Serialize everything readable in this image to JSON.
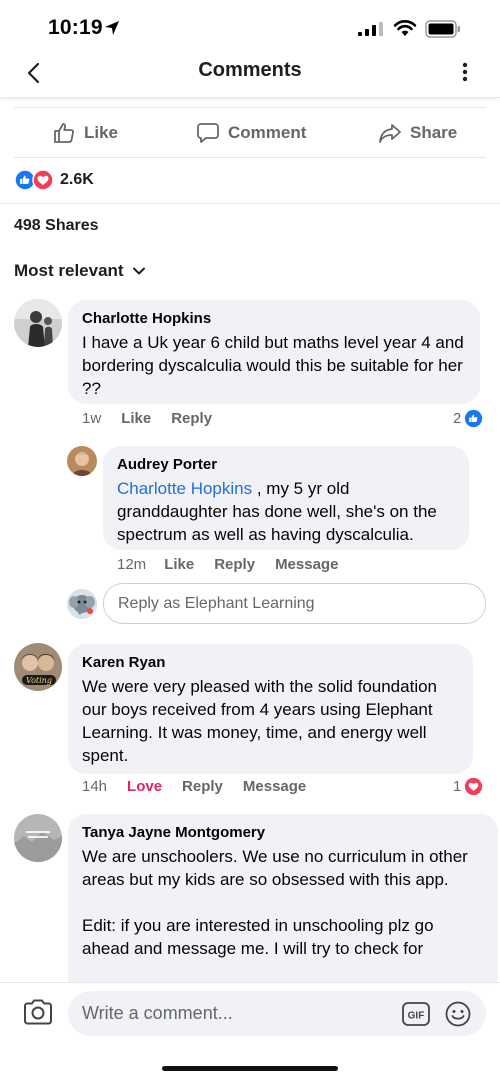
{
  "status_bar": {
    "time": "10:19"
  },
  "nav": {
    "title": "Comments"
  },
  "actions": {
    "like": "Like",
    "comment": "Comment",
    "share": "Share"
  },
  "reactions": {
    "count": "2.6K"
  },
  "shares": "498 Shares",
  "sort": {
    "label": "Most relevant"
  },
  "comments": [
    {
      "author": "Charlotte Hopkins",
      "text": "I have a Uk year 6 child but maths level year 4 and bordering dyscalculia would this be suitable for her ??",
      "time": "1w",
      "like": "Like",
      "reply": "Reply",
      "reaction_count": "2"
    },
    {
      "author": "Audrey Porter",
      "mention": "Charlotte Hopkins",
      "text": " , my 5 yr old granddaughter has done well, she's on the spectrum as well as having dyscalculia.",
      "time": "12m",
      "like": "Like",
      "reply": "Reply",
      "message": "Message"
    },
    {
      "author": "Karen Ryan",
      "text": "We were very pleased with the solid foundation our boys received from 4 years using Elephant Learning. It was money, time, and energy well spent.",
      "time": "14h",
      "love": "Love",
      "reply": "Reply",
      "message": "Message",
      "reaction_count": "1"
    },
    {
      "author": "Tanya Jayne Montgomery",
      "text": "We are unschoolers. We use no curriculum in other areas but my kids are so obsessed with this app.",
      "text2": "Edit: if you are interested in unschooling plz go ahead and message me. I will try to check for"
    }
  ],
  "reply_box": {
    "placeholder": "Reply as Elephant Learning"
  },
  "composer": {
    "placeholder": "Write a comment...",
    "gif": "GIF"
  },
  "colors": {
    "accent": "#1877f2",
    "love": "#e0245e",
    "bubble": "#f0f2f5",
    "link": "#216fdb"
  }
}
